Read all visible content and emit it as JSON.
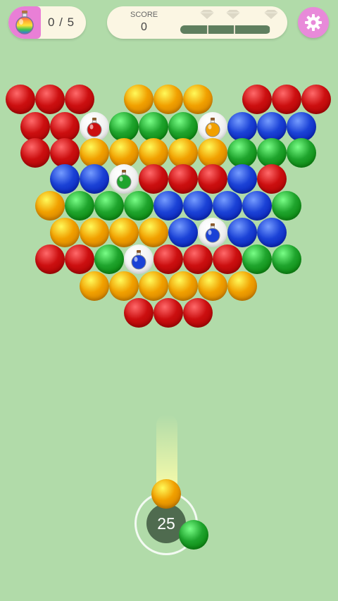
{
  "hud": {
    "potions_collected": "0 / 5",
    "score_label": "SCORE",
    "score_value": "0",
    "star_progress_fraction": 0.99,
    "milestone_icons": [
      "diamond-icon",
      "diamond-icon",
      "diamond-icon"
    ]
  },
  "shooter": {
    "shots_remaining": "25",
    "loaded_bubble": "orange",
    "next_bubble": "green"
  },
  "colors": {
    "red": "#cc0f10",
    "orange": "#f1a000",
    "green": "#1fa42d",
    "blue": "#1b42d6",
    "background": "#b1dba9",
    "hud_panel": "#fbf6e3",
    "accent_pink": "#e88ad9"
  },
  "board": {
    "rows": [
      [
        "red",
        "red",
        "red",
        null,
        "orange",
        "orange",
        "orange",
        null,
        "red",
        "red",
        "red"
      ],
      [
        "red",
        "red",
        "potion-red",
        "green",
        "green",
        "green",
        "potion-orange",
        "blue",
        "blue",
        "blue"
      ],
      [
        "red",
        "red",
        "orange",
        "orange",
        "orange",
        "orange",
        "orange",
        "green",
        "green",
        "green"
      ],
      [
        null,
        "blue",
        "blue",
        "potion-green",
        "red",
        "red",
        "red",
        "blue",
        "red",
        null
      ],
      [
        null,
        "orange",
        "green",
        "green",
        "green",
        "blue",
        "blue",
        "blue",
        "blue",
        "green",
        null
      ],
      [
        null,
        "orange",
        "orange",
        "orange",
        "orange",
        "blue",
        "potion-blue",
        "blue",
        "blue",
        null
      ],
      [
        null,
        "red",
        "red",
        "green",
        "potion-blue",
        "red",
        "red",
        "red",
        "green",
        "green",
        null
      ],
      [
        null,
        null,
        "orange",
        "orange",
        "orange",
        "orange",
        "orange",
        "orange",
        null,
        null
      ],
      [
        null,
        null,
        null,
        null,
        "red",
        "red",
        "red",
        null,
        null,
        null,
        null
      ]
    ]
  }
}
